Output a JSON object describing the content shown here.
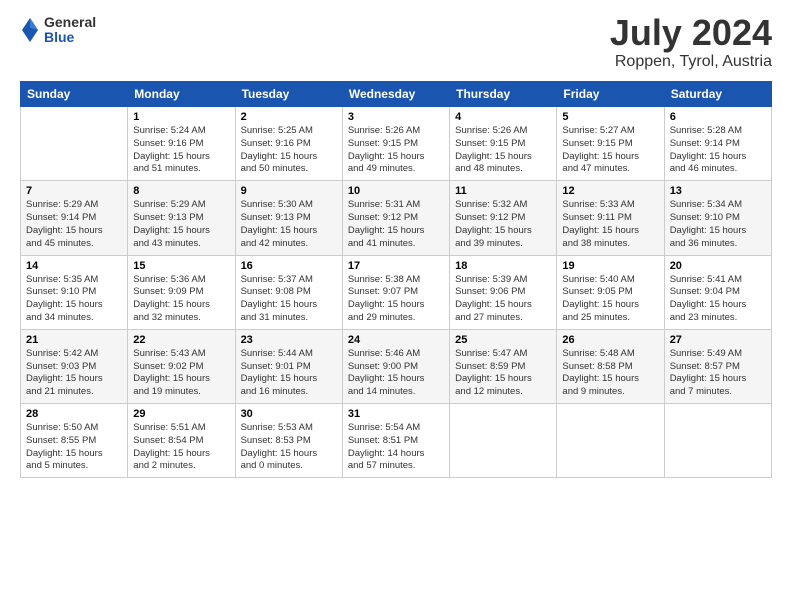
{
  "header": {
    "logo_general": "General",
    "logo_blue": "Blue",
    "title": "July 2024",
    "location": "Roppen, Tyrol, Austria"
  },
  "days_of_week": [
    "Sunday",
    "Monday",
    "Tuesday",
    "Wednesday",
    "Thursday",
    "Friday",
    "Saturday"
  ],
  "weeks": [
    [
      {
        "day": "",
        "info": ""
      },
      {
        "day": "1",
        "info": "Sunrise: 5:24 AM\nSunset: 9:16 PM\nDaylight: 15 hours\nand 51 minutes."
      },
      {
        "day": "2",
        "info": "Sunrise: 5:25 AM\nSunset: 9:16 PM\nDaylight: 15 hours\nand 50 minutes."
      },
      {
        "day": "3",
        "info": "Sunrise: 5:26 AM\nSunset: 9:15 PM\nDaylight: 15 hours\nand 49 minutes."
      },
      {
        "day": "4",
        "info": "Sunrise: 5:26 AM\nSunset: 9:15 PM\nDaylight: 15 hours\nand 48 minutes."
      },
      {
        "day": "5",
        "info": "Sunrise: 5:27 AM\nSunset: 9:15 PM\nDaylight: 15 hours\nand 47 minutes."
      },
      {
        "day": "6",
        "info": "Sunrise: 5:28 AM\nSunset: 9:14 PM\nDaylight: 15 hours\nand 46 minutes."
      }
    ],
    [
      {
        "day": "7",
        "info": "Sunrise: 5:29 AM\nSunset: 9:14 PM\nDaylight: 15 hours\nand 45 minutes."
      },
      {
        "day": "8",
        "info": "Sunrise: 5:29 AM\nSunset: 9:13 PM\nDaylight: 15 hours\nand 43 minutes."
      },
      {
        "day": "9",
        "info": "Sunrise: 5:30 AM\nSunset: 9:13 PM\nDaylight: 15 hours\nand 42 minutes."
      },
      {
        "day": "10",
        "info": "Sunrise: 5:31 AM\nSunset: 9:12 PM\nDaylight: 15 hours\nand 41 minutes."
      },
      {
        "day": "11",
        "info": "Sunrise: 5:32 AM\nSunset: 9:12 PM\nDaylight: 15 hours\nand 39 minutes."
      },
      {
        "day": "12",
        "info": "Sunrise: 5:33 AM\nSunset: 9:11 PM\nDaylight: 15 hours\nand 38 minutes."
      },
      {
        "day": "13",
        "info": "Sunrise: 5:34 AM\nSunset: 9:10 PM\nDaylight: 15 hours\nand 36 minutes."
      }
    ],
    [
      {
        "day": "14",
        "info": "Sunrise: 5:35 AM\nSunset: 9:10 PM\nDaylight: 15 hours\nand 34 minutes."
      },
      {
        "day": "15",
        "info": "Sunrise: 5:36 AM\nSunset: 9:09 PM\nDaylight: 15 hours\nand 32 minutes."
      },
      {
        "day": "16",
        "info": "Sunrise: 5:37 AM\nSunset: 9:08 PM\nDaylight: 15 hours\nand 31 minutes."
      },
      {
        "day": "17",
        "info": "Sunrise: 5:38 AM\nSunset: 9:07 PM\nDaylight: 15 hours\nand 29 minutes."
      },
      {
        "day": "18",
        "info": "Sunrise: 5:39 AM\nSunset: 9:06 PM\nDaylight: 15 hours\nand 27 minutes."
      },
      {
        "day": "19",
        "info": "Sunrise: 5:40 AM\nSunset: 9:05 PM\nDaylight: 15 hours\nand 25 minutes."
      },
      {
        "day": "20",
        "info": "Sunrise: 5:41 AM\nSunset: 9:04 PM\nDaylight: 15 hours\nand 23 minutes."
      }
    ],
    [
      {
        "day": "21",
        "info": "Sunrise: 5:42 AM\nSunset: 9:03 PM\nDaylight: 15 hours\nand 21 minutes."
      },
      {
        "day": "22",
        "info": "Sunrise: 5:43 AM\nSunset: 9:02 PM\nDaylight: 15 hours\nand 19 minutes."
      },
      {
        "day": "23",
        "info": "Sunrise: 5:44 AM\nSunset: 9:01 PM\nDaylight: 15 hours\nand 16 minutes."
      },
      {
        "day": "24",
        "info": "Sunrise: 5:46 AM\nSunset: 9:00 PM\nDaylight: 15 hours\nand 14 minutes."
      },
      {
        "day": "25",
        "info": "Sunrise: 5:47 AM\nSunset: 8:59 PM\nDaylight: 15 hours\nand 12 minutes."
      },
      {
        "day": "26",
        "info": "Sunrise: 5:48 AM\nSunset: 8:58 PM\nDaylight: 15 hours\nand 9 minutes."
      },
      {
        "day": "27",
        "info": "Sunrise: 5:49 AM\nSunset: 8:57 PM\nDaylight: 15 hours\nand 7 minutes."
      }
    ],
    [
      {
        "day": "28",
        "info": "Sunrise: 5:50 AM\nSunset: 8:55 PM\nDaylight: 15 hours\nand 5 minutes."
      },
      {
        "day": "29",
        "info": "Sunrise: 5:51 AM\nSunset: 8:54 PM\nDaylight: 15 hours\nand 2 minutes."
      },
      {
        "day": "30",
        "info": "Sunrise: 5:53 AM\nSunset: 8:53 PM\nDaylight: 15 hours\nand 0 minutes."
      },
      {
        "day": "31",
        "info": "Sunrise: 5:54 AM\nSunset: 8:51 PM\nDaylight: 14 hours\nand 57 minutes."
      },
      {
        "day": "",
        "info": ""
      },
      {
        "day": "",
        "info": ""
      },
      {
        "day": "",
        "info": ""
      }
    ]
  ]
}
